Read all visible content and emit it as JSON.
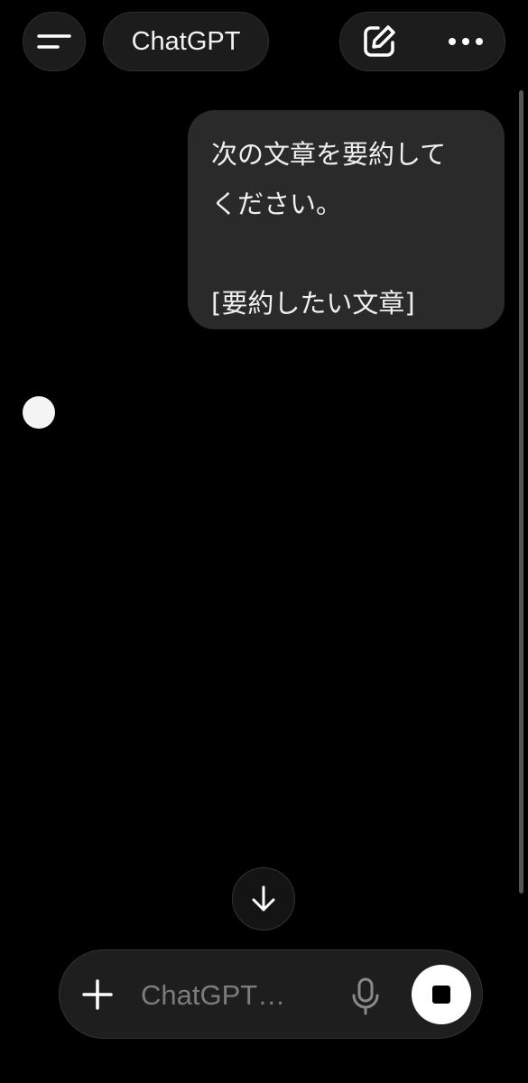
{
  "header": {
    "title": "ChatGPT",
    "menu_icon": "menu-icon",
    "new_chat_icon": "edit-icon",
    "more_icon": "more-icon"
  },
  "conversation": {
    "user_message": "次の文章を要約して\nください。\n\n[要約したい文章]",
    "assistant_status": "thinking"
  },
  "composer": {
    "placeholder": "ChatGPT…",
    "value": "",
    "plus_icon": "plus-icon",
    "mic_icon": "mic-icon",
    "stop_icon": "stop-icon"
  },
  "scroll_down_icon": "arrow-down-icon",
  "colors": {
    "background": "#000000",
    "bubble": "#2a2a2a",
    "pill": "#1c1c1c",
    "accent": "#ffffff"
  }
}
